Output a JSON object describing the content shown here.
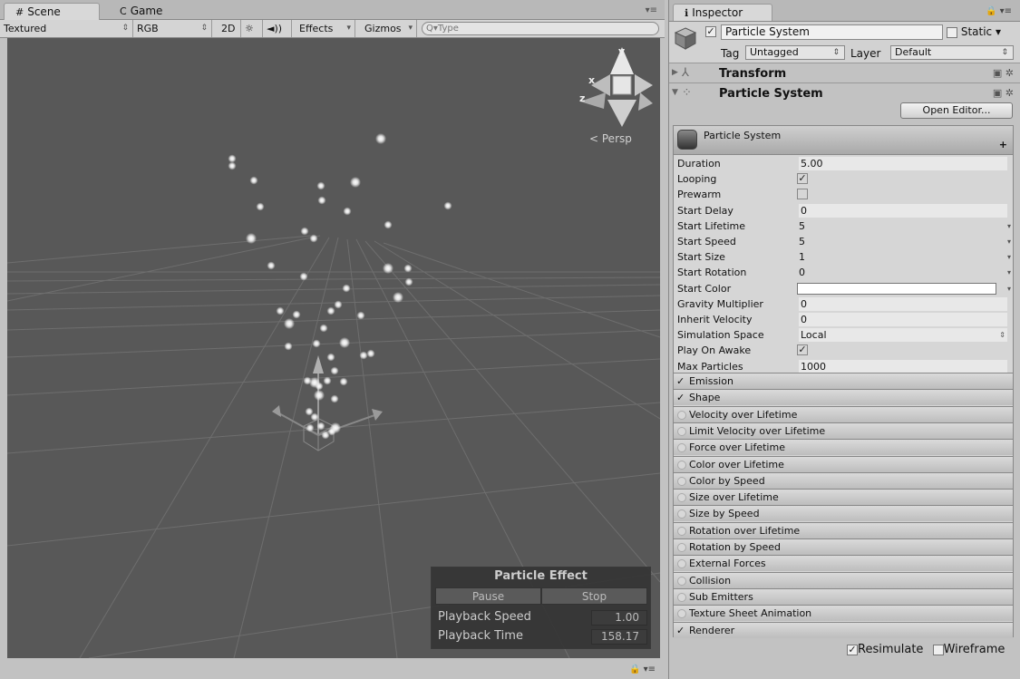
{
  "scene_panel": {
    "tabs": [
      {
        "icon": "#",
        "label": "Scene"
      },
      {
        "icon": "C",
        "label": "Game"
      }
    ],
    "toolbar": {
      "shading": "Textured",
      "render_mode": "RGB",
      "mode_2d": "2D",
      "effects": "Effects",
      "gizmos": "Gizmos",
      "search_placeholder": "Type"
    },
    "gizmo": {
      "y": "y",
      "x": "x",
      "z": "z",
      "projection": "Persp"
    }
  },
  "particle_effect": {
    "title": "Particle Effect",
    "pause_label": "Pause",
    "stop_label": "Stop",
    "playback_speed_label": "Playback Speed",
    "playback_speed": "1.00",
    "playback_time_label": "Playback Time",
    "playback_time": "158.17"
  },
  "inspector": {
    "tab_label": "Inspector",
    "object_name": "Particle System",
    "static_label": "Static",
    "tag_label": "Tag",
    "tag_value": "Untagged",
    "layer_label": "Layer",
    "layer_value": "Default",
    "components": [
      {
        "name": "Transform"
      },
      {
        "name": "Particle System"
      }
    ],
    "open_editor_label": "Open Editor...",
    "ps_header": "Particle System",
    "properties": [
      {
        "label": "Duration",
        "value": "5.00",
        "kind": "field"
      },
      {
        "label": "Looping",
        "value": "✓",
        "kind": "check"
      },
      {
        "label": "Prewarm",
        "value": "",
        "kind": "check"
      },
      {
        "label": "Start Delay",
        "value": "0",
        "kind": "field"
      },
      {
        "label": "Start Lifetime",
        "value": "5",
        "kind": "dropdown"
      },
      {
        "label": "Start Speed",
        "value": "5",
        "kind": "dropdown"
      },
      {
        "label": "Start Size",
        "value": "1",
        "kind": "dropdown"
      },
      {
        "label": "Start Rotation",
        "value": "0",
        "kind": "dropdown"
      },
      {
        "label": "Start Color",
        "value": "",
        "kind": "color"
      },
      {
        "label": "Gravity Multiplier",
        "value": "0",
        "kind": "field"
      },
      {
        "label": "Inherit Velocity",
        "value": "0",
        "kind": "field"
      },
      {
        "label": "Simulation Space",
        "value": "Local",
        "kind": "select"
      },
      {
        "label": "Play On Awake",
        "value": "✓",
        "kind": "check"
      },
      {
        "label": "Max Particles",
        "value": "1000",
        "kind": "field"
      }
    ],
    "modules": [
      {
        "label": "Emission",
        "enabled": true
      },
      {
        "label": "Shape",
        "enabled": true
      },
      {
        "label": "Velocity over Lifetime",
        "enabled": false
      },
      {
        "label": "Limit Velocity over Lifetime",
        "enabled": false
      },
      {
        "label": "Force over Lifetime",
        "enabled": false
      },
      {
        "label": "Color over Lifetime",
        "enabled": false
      },
      {
        "label": "Color by Speed",
        "enabled": false
      },
      {
        "label": "Size over Lifetime",
        "enabled": false
      },
      {
        "label": "Size by Speed",
        "enabled": false
      },
      {
        "label": "Rotation over Lifetime",
        "enabled": false
      },
      {
        "label": "Rotation by Speed",
        "enabled": false
      },
      {
        "label": "External Forces",
        "enabled": false
      },
      {
        "label": "Collision",
        "enabled": false
      },
      {
        "label": "Sub Emitters",
        "enabled": false
      },
      {
        "label": "Texture Sheet Animation",
        "enabled": false
      },
      {
        "label": "Renderer",
        "enabled": true
      }
    ],
    "resimulate_label": "Resimulate",
    "wireframe_label": "Wireframe"
  }
}
